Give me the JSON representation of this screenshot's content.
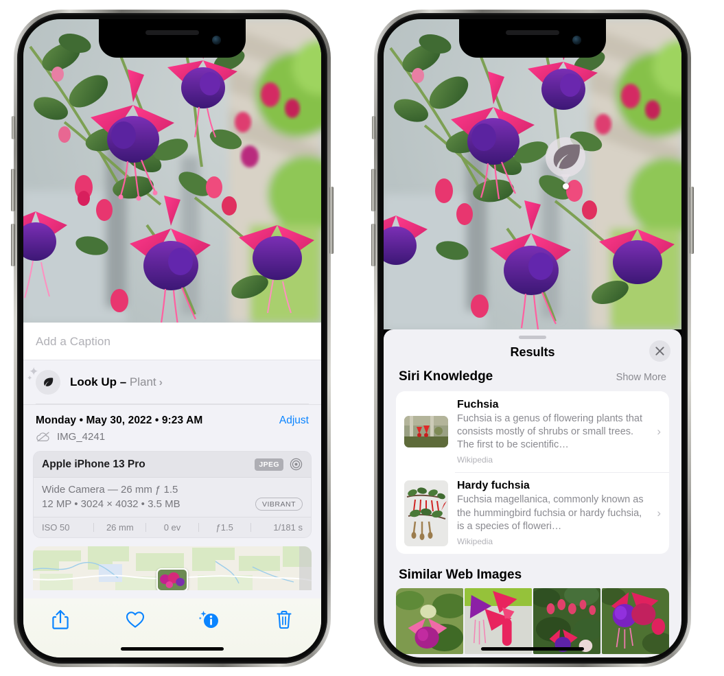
{
  "left_phone": {
    "caption": {
      "placeholder": "Add a Caption",
      "value": ""
    },
    "lookup": {
      "label": "Look Up – ",
      "subject": "Plant",
      "icon": "leaf-icon",
      "chevron": "›"
    },
    "metadata": {
      "date_line": "Monday • May 30, 2022 • 9:23 AM",
      "adjust_label": "Adjust",
      "file_name": "IMG_4241",
      "cloud_icon": "cloud-slash-icon"
    },
    "camera_card": {
      "device": "Apple iPhone 13 Pro",
      "format_tag": "JPEG",
      "aperture_icon": "aperture-icon",
      "lens_line": "Wide Camera — 26 mm ƒ 1.5",
      "size_line": "12 MP • 3024 × 4032 • 3.5 MB",
      "style_tag": "VIBRANT",
      "exif": [
        "ISO 50",
        "26 mm",
        "0 ev",
        "ƒ1.5",
        "1/181 s"
      ]
    },
    "toolbar": [
      {
        "name": "share-button",
        "icon": "share-icon"
      },
      {
        "name": "favorite-button",
        "icon": "heart-icon"
      },
      {
        "name": "info-button",
        "icon": "info-sparkle-icon"
      },
      {
        "name": "delete-button",
        "icon": "trash-icon"
      }
    ]
  },
  "right_phone": {
    "visual_lookup_badge": {
      "icon": "leaf-icon"
    },
    "sheet": {
      "title": "Results",
      "close_icon": "close-icon",
      "sections": [
        {
          "title": "Siri Knowledge",
          "action_label": "Show More",
          "items": [
            {
              "title": "Fuchsia",
              "description": "Fuchsia is a genus of flowering plants that consists mostly of shrubs or small trees. The first to be scientific…",
              "source": "Wikipedia",
              "chevron": "›"
            },
            {
              "title": "Hardy fuchsia",
              "description": "Fuchsia magellanica, commonly known as the hummingbird fuchsia or hardy fuchsia, is a species of floweri…",
              "source": "Wikipedia",
              "chevron": "›"
            }
          ]
        },
        {
          "title": "Similar Web Images",
          "tiles": [
            "web-image-1",
            "web-image-2",
            "web-image-3",
            "web-image-4"
          ]
        }
      ]
    }
  },
  "colors": {
    "accent_blue": "#0a84ff",
    "sheet_bg": "#f1f1f5",
    "card_bg": "#ffffff",
    "secondary_text": "#8a8a90"
  }
}
